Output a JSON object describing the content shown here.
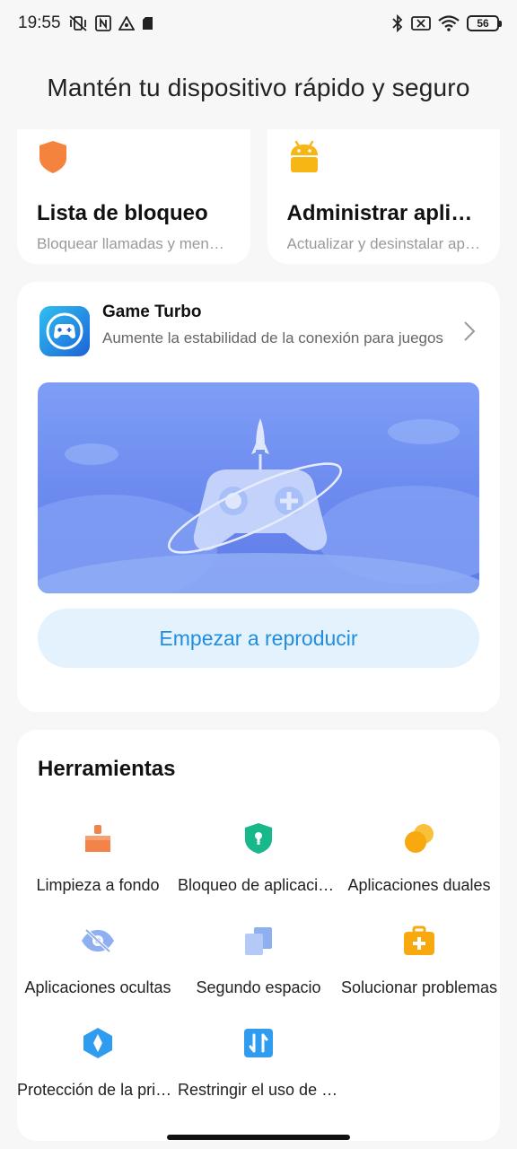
{
  "status_bar": {
    "time": "19:55",
    "battery": "56",
    "left_icons": [
      "mute-vibrate-icon",
      "nfc-icon",
      "drive-icon",
      "sd-card-icon"
    ],
    "right_icons": [
      "bluetooth-icon",
      "no-sim-icon",
      "wifi-icon",
      "battery-icon"
    ]
  },
  "page": {
    "title": "Mantén tu dispositivo rápido y seguro"
  },
  "top_cards": [
    {
      "title": "Lista de bloqueo",
      "subtitle": "Bloquear llamadas y mensajes",
      "icon": "shield-icon",
      "color": "#f4833d"
    },
    {
      "title": "Administrar aplicaciones",
      "subtitle": "Actualizar y desinstalar aplicaciones",
      "icon": "android-icon",
      "color": "#f8b614"
    }
  ],
  "game_turbo": {
    "title": "Game Turbo",
    "subtitle": "Aumente la estabilidad de la conexión para juegos",
    "button": "Empezar a reproducir",
    "icon": "gamepad-icon",
    "button_color": "#1f8ee0"
  },
  "tools": {
    "title": "Herramientas",
    "items": [
      {
        "label": "Limpieza a fondo",
        "icon": "broom-icon",
        "color": "#f4834a"
      },
      {
        "label": "Bloqueo de aplicaciones",
        "icon": "app-lock-icon",
        "color": "#17b88a"
      },
      {
        "label": "Aplicaciones duales",
        "icon": "dual-apps-icon",
        "color": "#f7a90f"
      },
      {
        "label": "Aplicaciones ocultas",
        "icon": "eye-off-icon",
        "color": "#8fb0f0"
      },
      {
        "label": "Segundo espacio",
        "icon": "second-space-icon",
        "color": "#8fb0f0"
      },
      {
        "label": "Solucionar problemas",
        "icon": "first-aid-icon",
        "color": "#f7a90f"
      },
      {
        "label": "Protección de la privacidad",
        "icon": "privacy-icon",
        "color": "#2f9cf0"
      },
      {
        "label": "Restringir el uso de datos",
        "icon": "data-usage-icon",
        "color": "#2f9cf0"
      }
    ]
  }
}
